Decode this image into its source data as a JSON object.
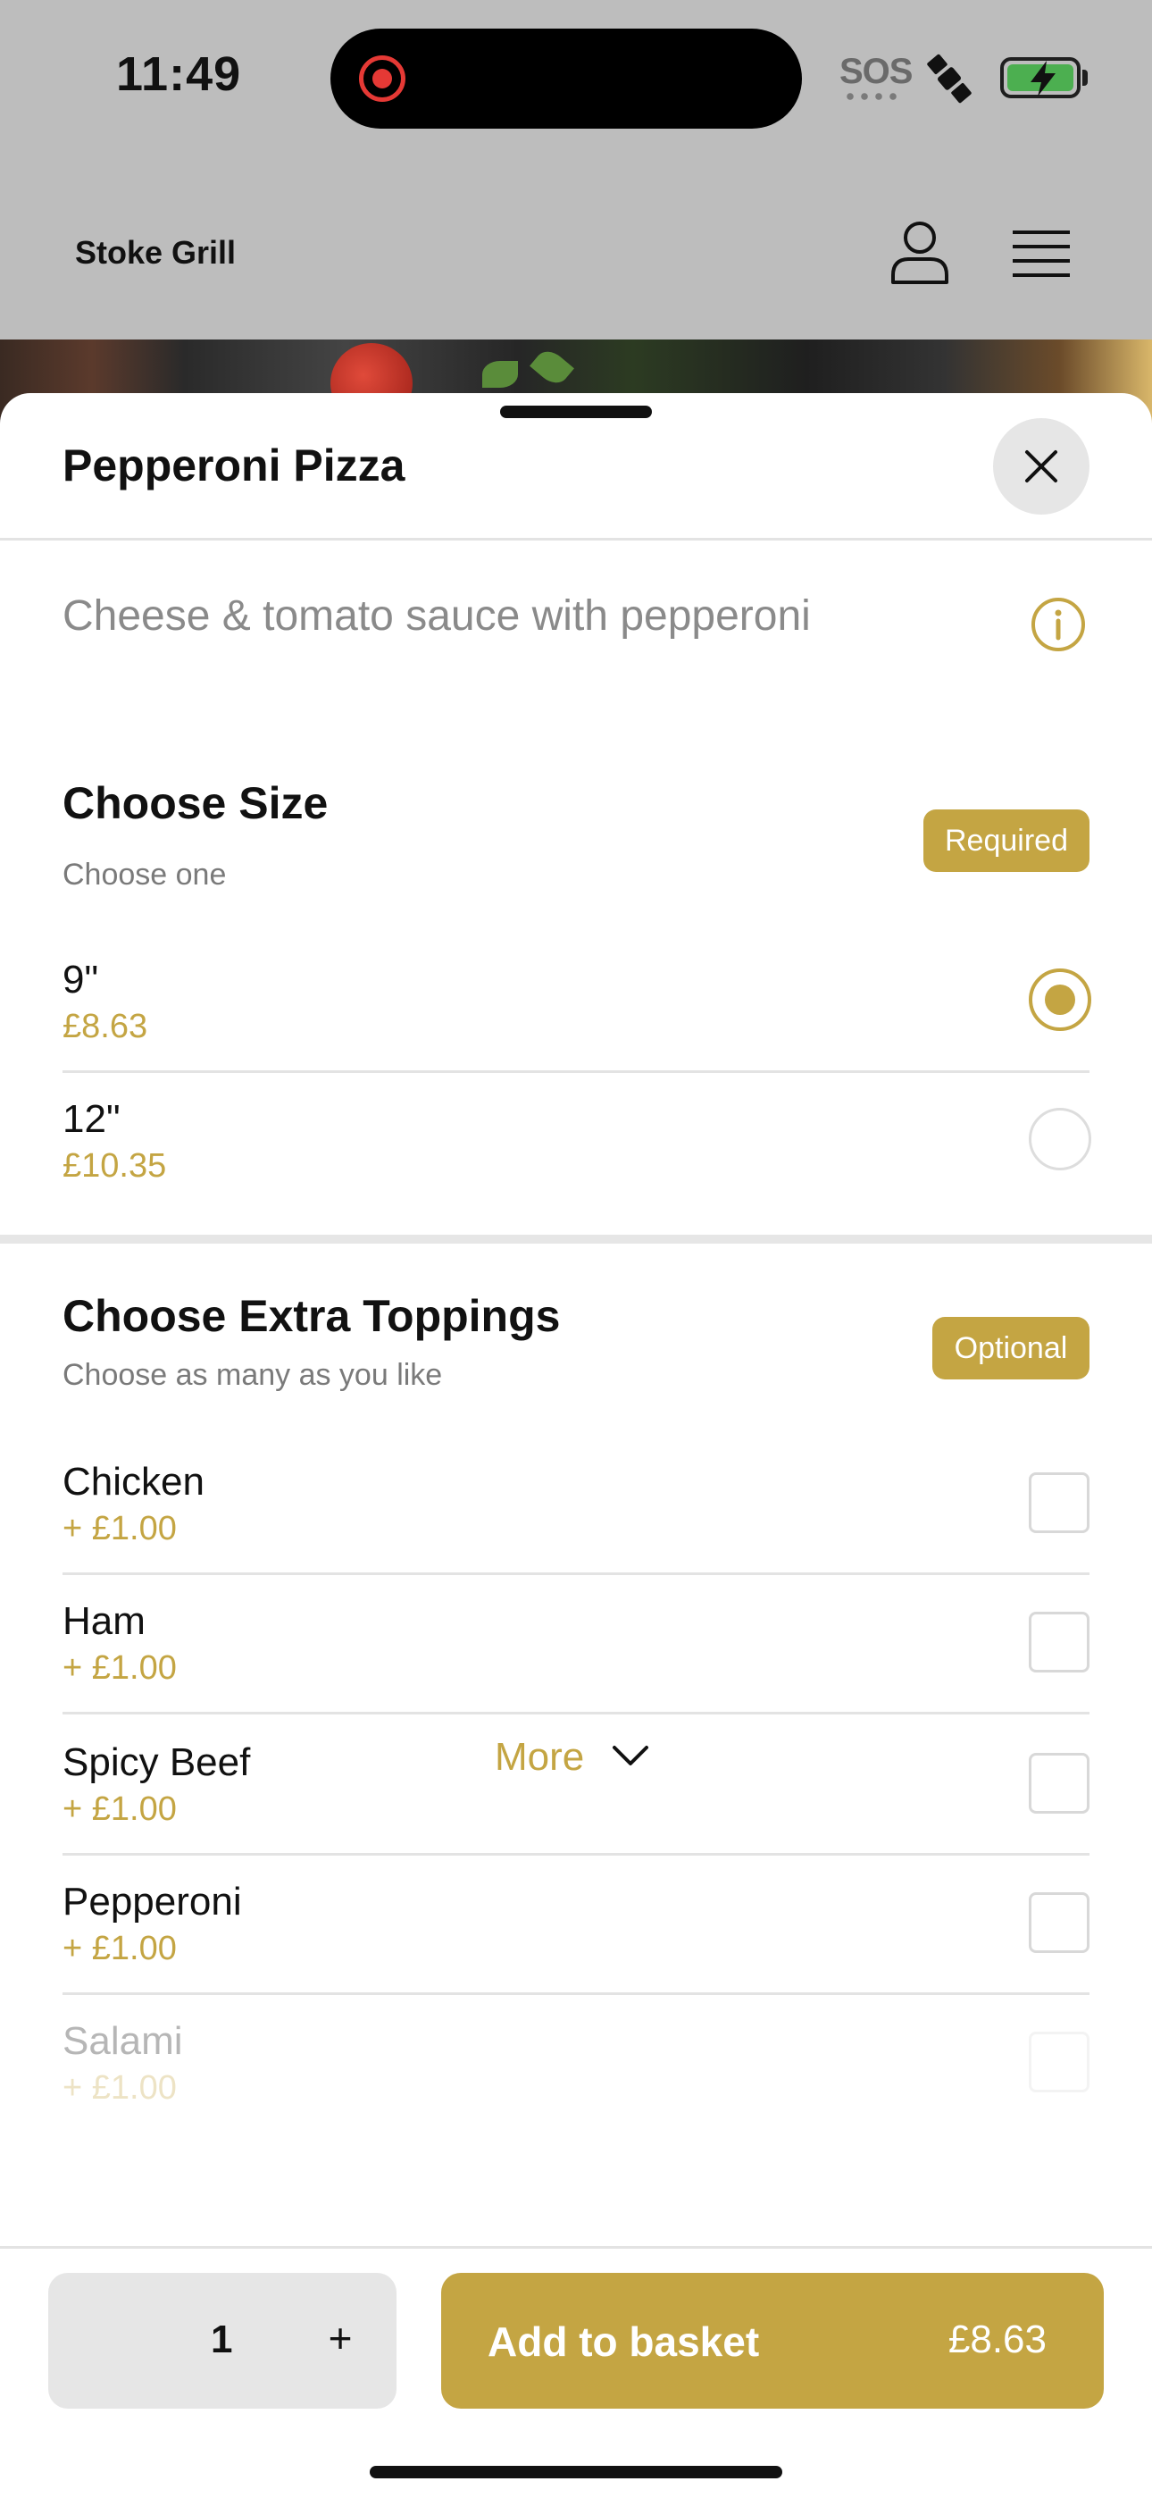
{
  "status_bar": {
    "time": "11:49",
    "sos": "SOS",
    "battery_color": "#4caf50",
    "record_color": "#e53935"
  },
  "header": {
    "brand": "Stoke Grill",
    "user_icon": "user-icon",
    "menu_icon": "menu-icon"
  },
  "sheet": {
    "title": "Pepperoni Pizza",
    "description": "Cheese & tomato sauce with pepperoni",
    "close_icon": "close-icon",
    "info_icon": "info-icon"
  },
  "size_section": {
    "title": "Choose Size",
    "subtitle": "Choose one",
    "badge": "Required",
    "options": [
      {
        "name": "9\"",
        "price": "£8.63",
        "selected": true
      },
      {
        "name": "12\"",
        "price": "£10.35",
        "selected": false
      }
    ]
  },
  "toppings_section": {
    "title": "Choose Extra Toppings",
    "subtitle": "Choose as many as you like",
    "badge": "Optional",
    "options": [
      {
        "name": "Chicken",
        "price": "+ £1.00",
        "checked": false
      },
      {
        "name": "Ham",
        "price": "+ £1.00",
        "checked": false
      },
      {
        "name": "Spicy Beef",
        "price": "+ £1.00",
        "checked": false
      },
      {
        "name": "Pepperoni",
        "price": "+ £1.00",
        "checked": false
      },
      {
        "name": "Salami",
        "price": "+ £1.00",
        "checked": false
      }
    ],
    "more_label": "More"
  },
  "footer": {
    "quantity": "1",
    "plus_label": "+",
    "add_label": "Add to basket",
    "total": "£8.63"
  },
  "colors": {
    "accent": "#c4a543",
    "overlay": "#bdbdbd"
  }
}
